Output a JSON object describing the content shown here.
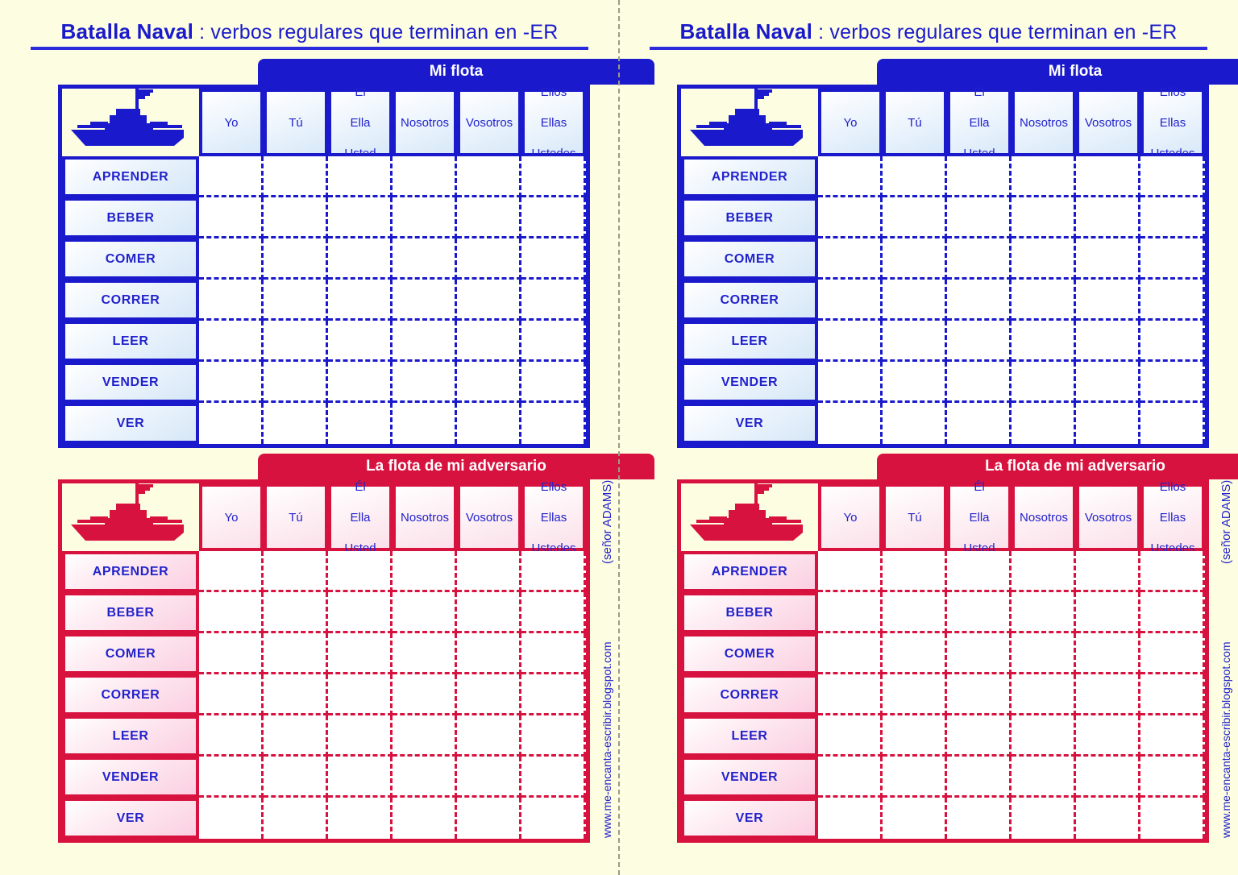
{
  "document": {
    "background_color": "#FDFDE2",
    "accent_blue": "#1A1ACC",
    "accent_red": "#D8123F"
  },
  "title": {
    "strong": "Batalla Naval",
    "rest": " : verbos regulares que terminan en -ER"
  },
  "banners": {
    "own_fleet": "Mi flota",
    "opponent_fleet": "La flota de mi adversario"
  },
  "pronouns": [
    "Yo",
    "Tú",
    "Él\nElla\nUsted",
    "Nosotros",
    "Vosotros",
    "Ellos\nEllas\nUstedes"
  ],
  "verbs": [
    "APRENDER",
    "BEBER",
    "COMER",
    "CORRER",
    "LEER",
    "VENDER",
    "VER"
  ],
  "credits": {
    "author": "(señor ADAMS)",
    "website": "www.me-encanta-escribir.blogspot.com"
  },
  "icons": {
    "battleship": "battleship-icon"
  }
}
